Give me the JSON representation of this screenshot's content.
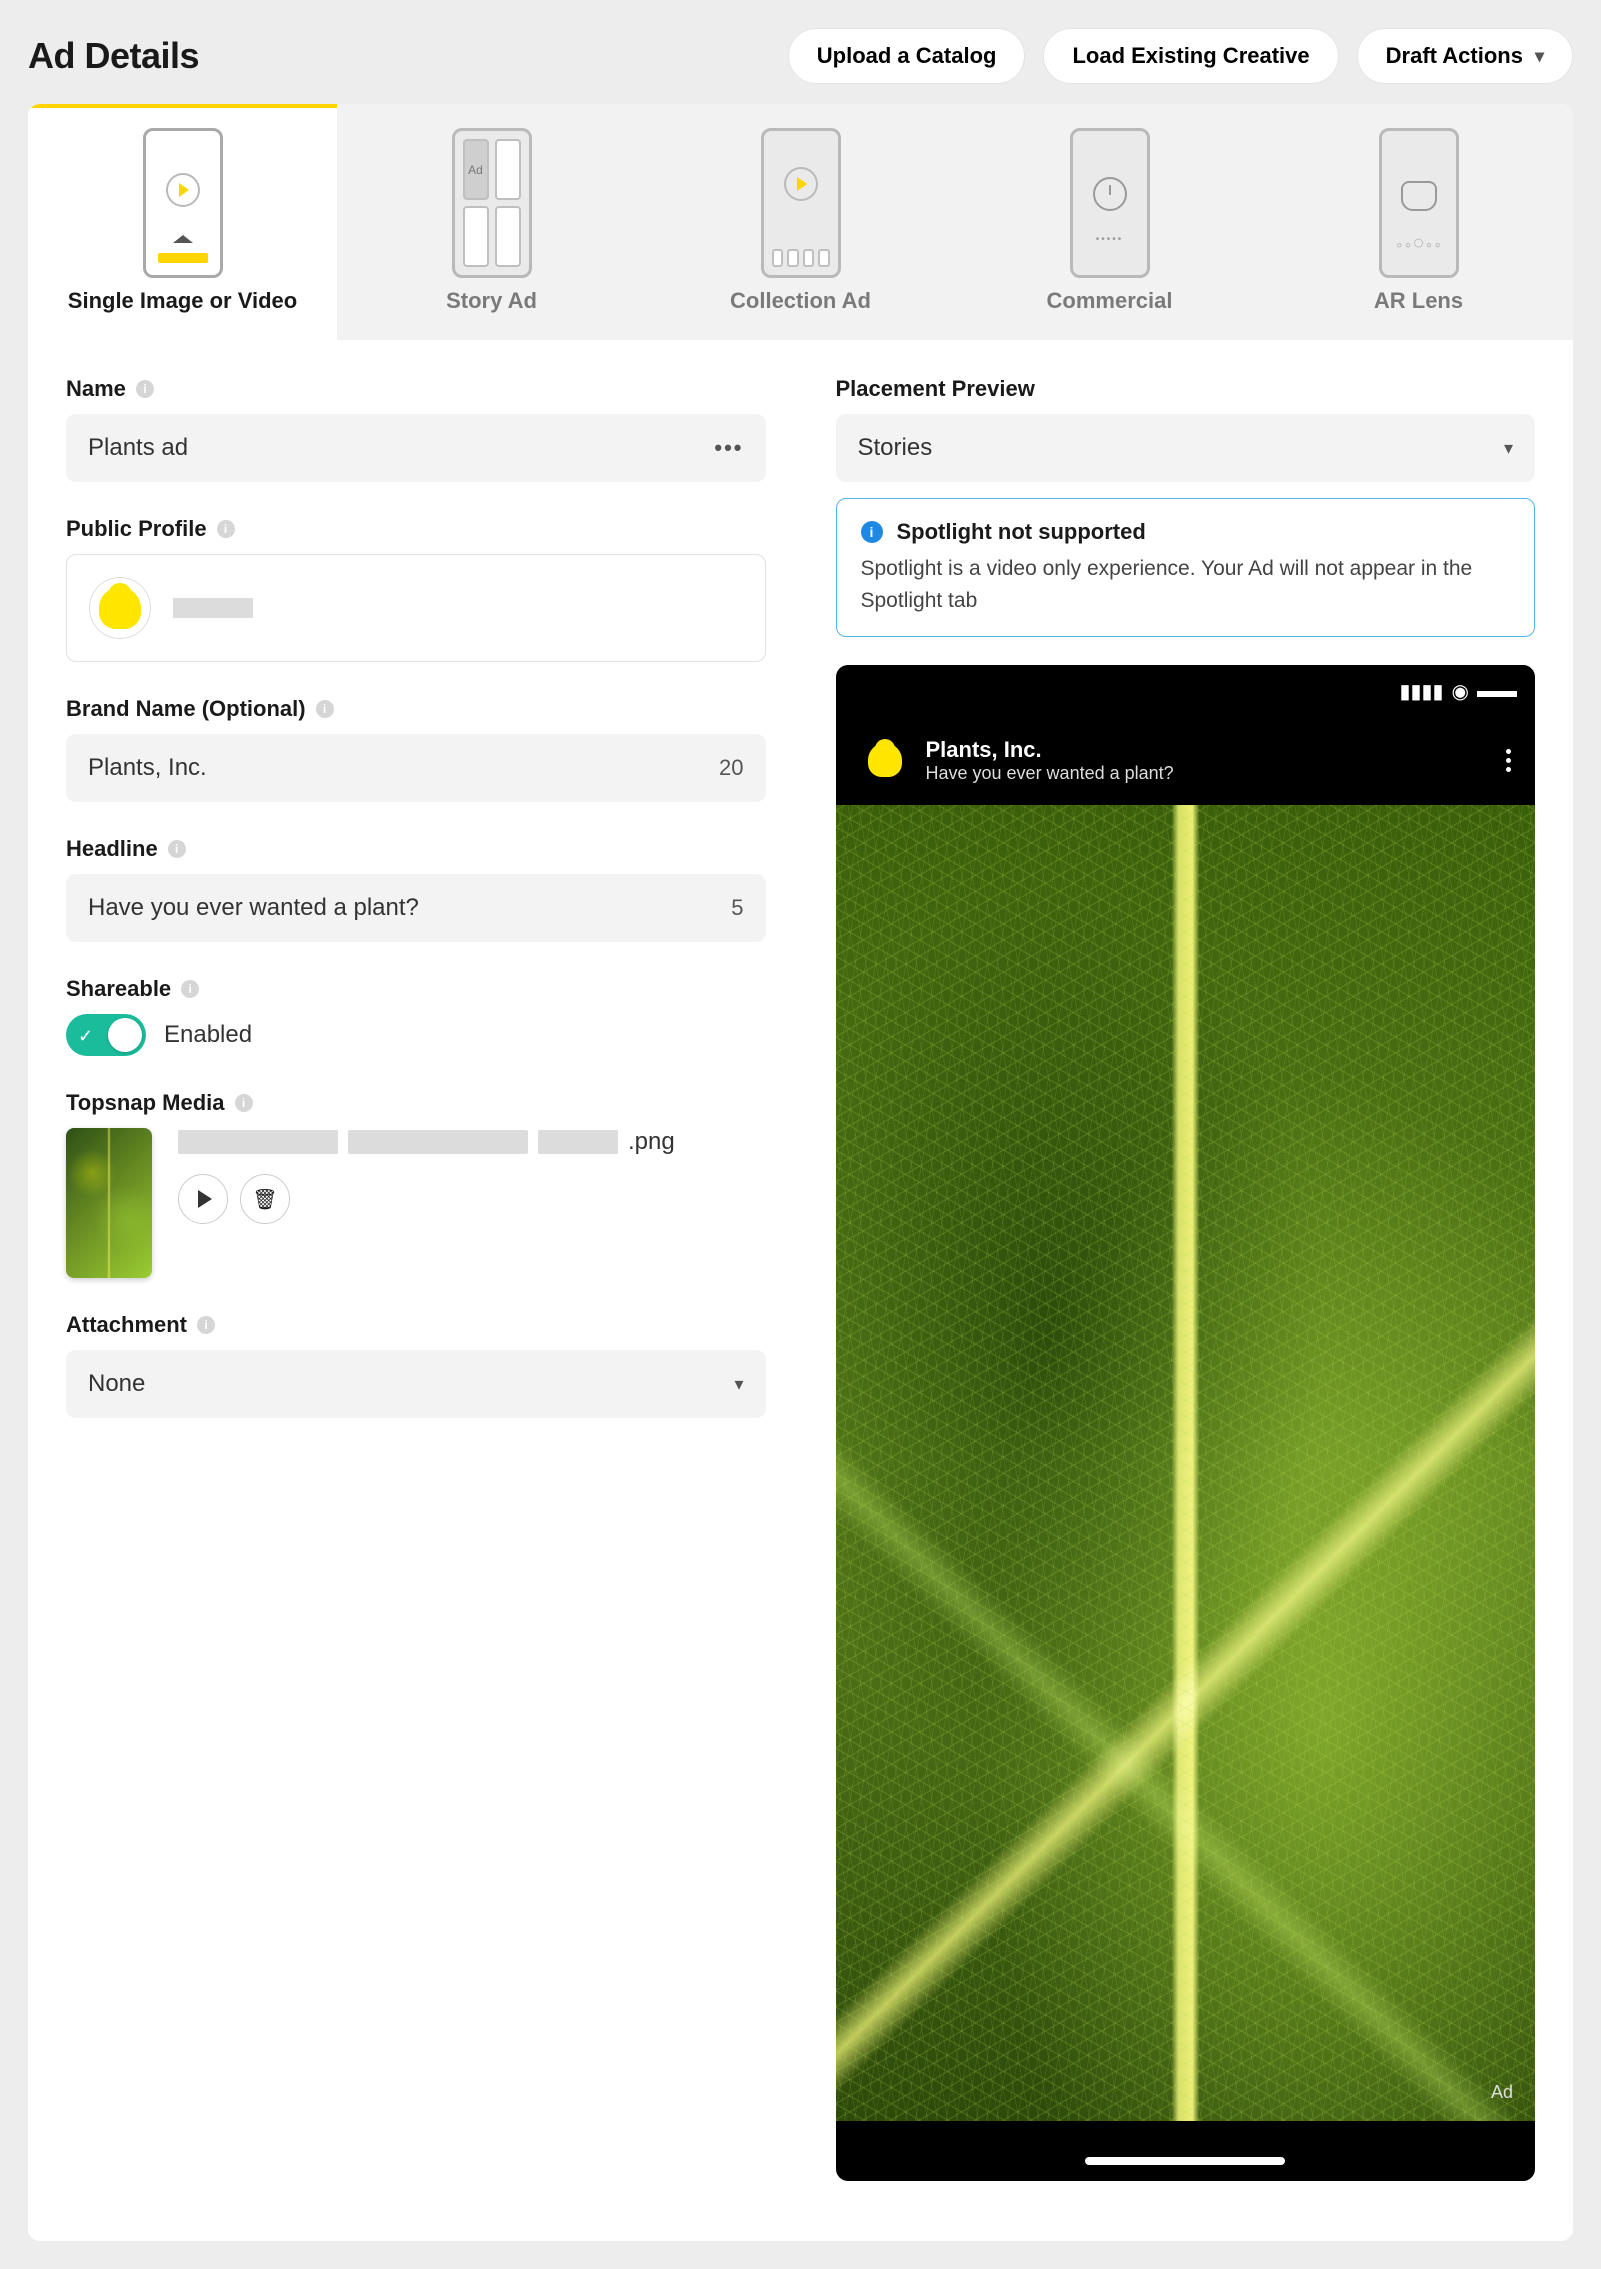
{
  "header": {
    "title": "Ad Details",
    "buttons": {
      "upload": "Upload a Catalog",
      "load": "Load Existing Creative",
      "draft": "Draft Actions"
    }
  },
  "tabs": [
    {
      "id": "single",
      "label": "Single Image or Video",
      "active": true
    },
    {
      "id": "story",
      "label": "Story Ad",
      "active": false
    },
    {
      "id": "collection",
      "label": "Collection Ad",
      "active": false
    },
    {
      "id": "commercial",
      "label": "Commercial",
      "active": false
    },
    {
      "id": "arlens",
      "label": "AR Lens",
      "active": false
    }
  ],
  "form": {
    "name": {
      "label": "Name",
      "value": "Plants ad"
    },
    "publicProfile": {
      "label": "Public Profile"
    },
    "brand": {
      "label": "Brand Name (Optional)",
      "value": "Plants, Inc.",
      "counter": "20"
    },
    "headline": {
      "label": "Headline",
      "value": "Have you ever wanted a plant?",
      "counter": "5"
    },
    "shareable": {
      "label": "Shareable",
      "status": "Enabled",
      "on": true
    },
    "media": {
      "label": "Topsnap Media",
      "ext": ".png"
    },
    "attachment": {
      "label": "Attachment",
      "value": "None"
    }
  },
  "preview": {
    "label": "Placement Preview",
    "placement": "Stories",
    "alert": {
      "title": "Spotlight not supported",
      "body": "Spotlight is a video only experience. Your Ad will not appear in the Spotlight tab"
    },
    "phone": {
      "brand": "Plants, Inc.",
      "headline": "Have you ever wanted a plant?",
      "badge": "Ad"
    }
  }
}
